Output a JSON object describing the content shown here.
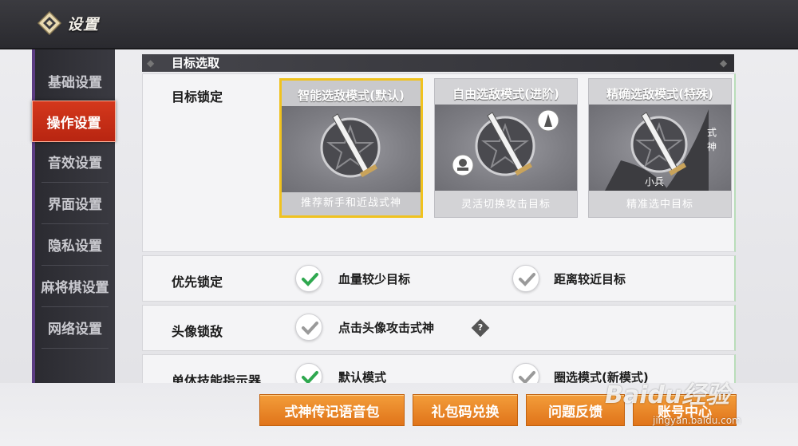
{
  "header": {
    "title": "设置"
  },
  "sidebar": {
    "items": [
      {
        "label": "基础设置",
        "active": false
      },
      {
        "label": "操作设置",
        "active": true
      },
      {
        "label": "音效设置",
        "active": false
      },
      {
        "label": "界面设置",
        "active": false
      },
      {
        "label": "隐私设置",
        "active": false
      },
      {
        "label": "麻将棋设置",
        "active": false
      },
      {
        "label": "网络设置",
        "active": false
      }
    ]
  },
  "section": {
    "title": "目标选取"
  },
  "target_lock": {
    "label": "目标锁定",
    "modes": [
      {
        "title": "智能选敌模式(默认)",
        "desc": "推荐新手和近战式神",
        "selected": true
      },
      {
        "title": "自由选敌模式(进阶)",
        "desc": "灵活切换攻击目标",
        "selected": false
      },
      {
        "title": "精确选敌模式(特殊)",
        "desc": "精准选中目标",
        "selected": false,
        "art_labels": [
          "式神",
          "小兵"
        ]
      }
    ]
  },
  "priority_lock": {
    "label": "优先锁定",
    "options": [
      {
        "label": "血量较少目标",
        "checked": true
      },
      {
        "label": "距离较近目标",
        "checked": false
      }
    ]
  },
  "avatar_lock": {
    "label": "头像锁敌",
    "option": {
      "label": "点击头像攻击式神",
      "checked": false
    },
    "help_icon": "?"
  },
  "skill_indicator": {
    "label": "单体技能指示器",
    "options": [
      {
        "label": "默认模式",
        "checked": true
      },
      {
        "label": "圈选模式(新模式)",
        "checked": false
      }
    ]
  },
  "bottom_buttons": [
    {
      "label": "式神传记语音包"
    },
    {
      "label": "礼包码兑换"
    },
    {
      "label": "问题反馈"
    },
    {
      "label": "账号中心"
    }
  ],
  "watermark": {
    "text": "Baidu经验",
    "sub": "jingyan.baidu.com"
  },
  "colors": {
    "active_tab": "#d4381c",
    "selected_border": "#f0c21e",
    "button_orange": "#e0741a",
    "check_green": "#2fa84f",
    "check_gray": "#9a9a9a"
  }
}
